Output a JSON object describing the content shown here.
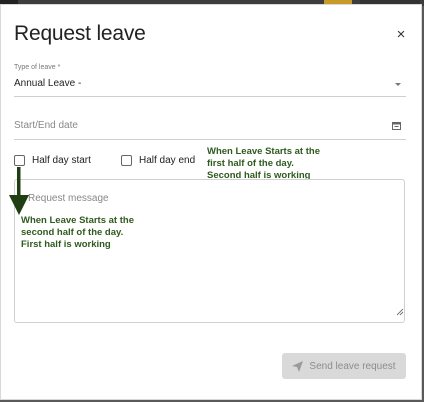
{
  "dialog": {
    "title": "Request leave",
    "close_glyph": "×"
  },
  "leave_type": {
    "label": "Type of leave *",
    "value": "Annual Leave -"
  },
  "date": {
    "placeholder": "Start/End date"
  },
  "half_day": {
    "start_label": "Half day start",
    "end_label": "Half day end",
    "start_checked": false,
    "end_checked": false
  },
  "message": {
    "placeholder": "Request message"
  },
  "annotations": {
    "right_note": "When Leave Starts at the\nfirst half of the day.\nSecond half is working",
    "left_note": "When Leave Starts at the\nsecond half of the day.\nFirst half is working"
  },
  "actions": {
    "send_label": "Send leave request"
  },
  "icons": {
    "close": "close-icon",
    "calendar": "calendar-icon",
    "send": "paper-plane-icon",
    "caret": "chevron-down-icon"
  },
  "colors": {
    "annotation": "#2f5a1e",
    "button_disabled_bg": "#d9d9d9",
    "button_disabled_text": "#8d8d8d"
  }
}
